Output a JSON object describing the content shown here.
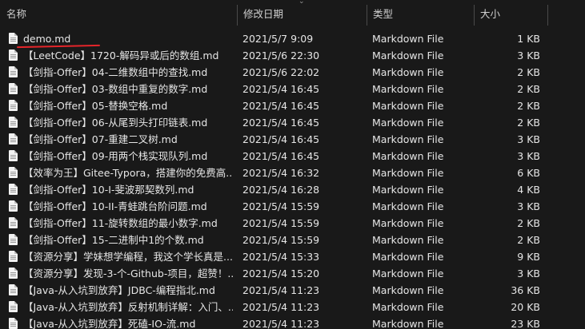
{
  "header": {
    "name": "名称",
    "date": "修改日期",
    "type": "类型",
    "size": "大小"
  },
  "files": [
    {
      "name": "demo.md",
      "date": "2021/5/7 9:09",
      "type": "Markdown File",
      "size": "1 KB"
    },
    {
      "name": "【LeetCode】1720-解码异或后的数组.md",
      "date": "2021/5/6 22:30",
      "type": "Markdown File",
      "size": "3 KB"
    },
    {
      "name": "【剑指-Offer】04-二维数组中的查找.md",
      "date": "2021/5/6 22:02",
      "type": "Markdown File",
      "size": "2 KB"
    },
    {
      "name": "【剑指-Offer】03-数组中重复的数字.md",
      "date": "2021/5/4 16:45",
      "type": "Markdown File",
      "size": "2 KB"
    },
    {
      "name": "【剑指-Offer】05-替换空格.md",
      "date": "2021/5/4 16:45",
      "type": "Markdown File",
      "size": "2 KB"
    },
    {
      "name": "【剑指-Offer】06-从尾到头打印链表.md",
      "date": "2021/5/4 16:45",
      "type": "Markdown File",
      "size": "2 KB"
    },
    {
      "name": "【剑指-Offer】07-重建二叉树.md",
      "date": "2021/5/4 16:45",
      "type": "Markdown File",
      "size": "3 KB"
    },
    {
      "name": "【剑指-Offer】09-用两个栈实现队列.md",
      "date": "2021/5/4 16:45",
      "type": "Markdown File",
      "size": "3 KB"
    },
    {
      "name": "【效率为王】Gitee-Typora，搭建你的免费高...",
      "date": "2021/5/4 16:32",
      "type": "Markdown File",
      "size": "6 KB"
    },
    {
      "name": "【剑指-Offer】10-I-斐波那契数列.md",
      "date": "2021/5/4 16:28",
      "type": "Markdown File",
      "size": "4 KB"
    },
    {
      "name": "【剑指-Offer】10-II-青蛙跳台阶问题.md",
      "date": "2021/5/4 15:59",
      "type": "Markdown File",
      "size": "3 KB"
    },
    {
      "name": "【剑指-Offer】11-旋转数组的最小数字.md",
      "date": "2021/5/4 15:59",
      "type": "Markdown File",
      "size": "2 KB"
    },
    {
      "name": "【剑指-Offer】15-二进制中1的个数.md",
      "date": "2021/5/4 15:59",
      "type": "Markdown File",
      "size": "2 KB"
    },
    {
      "name": "【资源分享】学妹想学编程，我这个学长真是...",
      "date": "2021/5/4 15:33",
      "type": "Markdown File",
      "size": "9 KB"
    },
    {
      "name": "【资源分享】发现-3-个-Github-项目，超赞！...",
      "date": "2021/5/4 15:20",
      "type": "Markdown File",
      "size": "3 KB"
    },
    {
      "name": "【Java-从入坑到放弃】JDBC-编程指北.md",
      "date": "2021/5/4 11:23",
      "type": "Markdown File",
      "size": "36 KB"
    },
    {
      "name": "【Java-从入坑到放弃】反射机制详解：入门、...",
      "date": "2021/5/4 11:23",
      "type": "Markdown File",
      "size": "20 KB"
    },
    {
      "name": "【Java-从入坑到放弃】死磕-IO-流.md",
      "date": "2021/5/4 11:23",
      "type": "Markdown File",
      "size": "23 KB"
    }
  ]
}
